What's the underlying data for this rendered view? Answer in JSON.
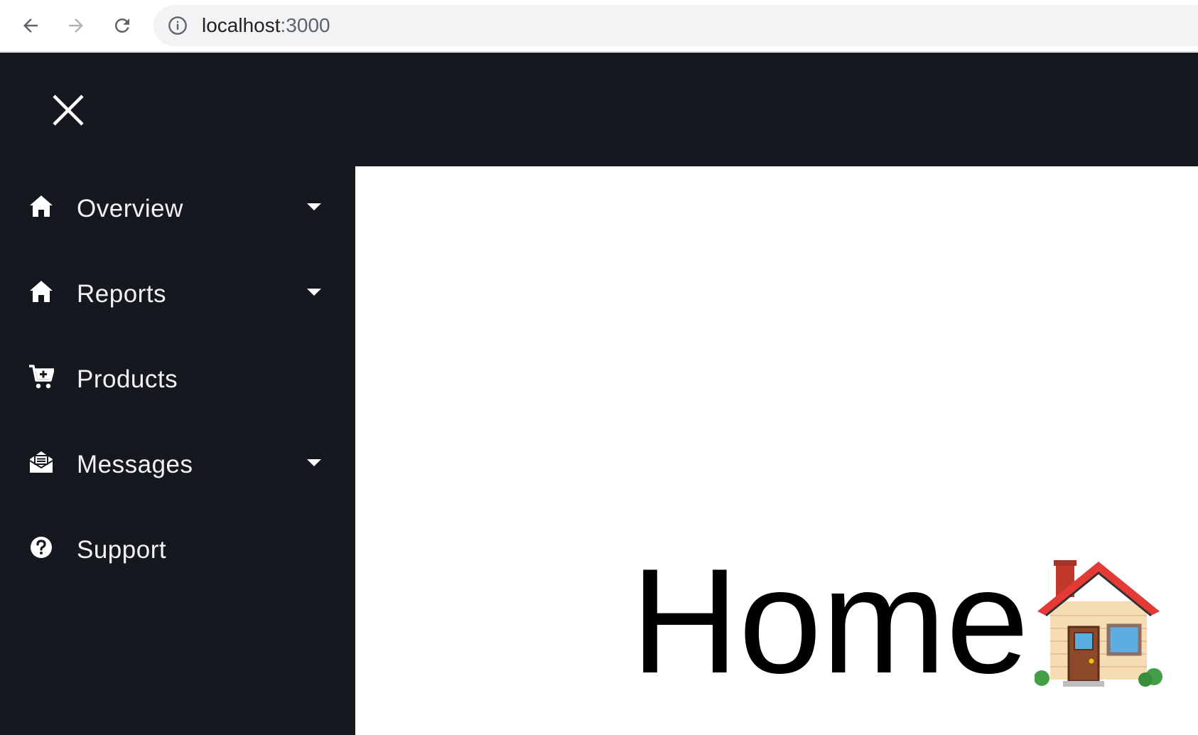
{
  "browser": {
    "url_host": "localhost",
    "url_port": ":3000"
  },
  "sidebar": {
    "items": [
      {
        "label": "Overview",
        "icon": "home-icon",
        "has_dropdown": true
      },
      {
        "label": "Reports",
        "icon": "home-icon",
        "has_dropdown": true
      },
      {
        "label": "Products",
        "icon": "cart-plus-icon",
        "has_dropdown": false
      },
      {
        "label": "Messages",
        "icon": "envelope-open-icon",
        "has_dropdown": true
      },
      {
        "label": "Support",
        "icon": "question-circle-icon",
        "has_dropdown": false
      }
    ]
  },
  "main": {
    "title": "Home"
  },
  "colors": {
    "sidebar_bg": "#15181e",
    "content_bg": "#ffffff",
    "sidebar_text": "#f2f2f2"
  }
}
